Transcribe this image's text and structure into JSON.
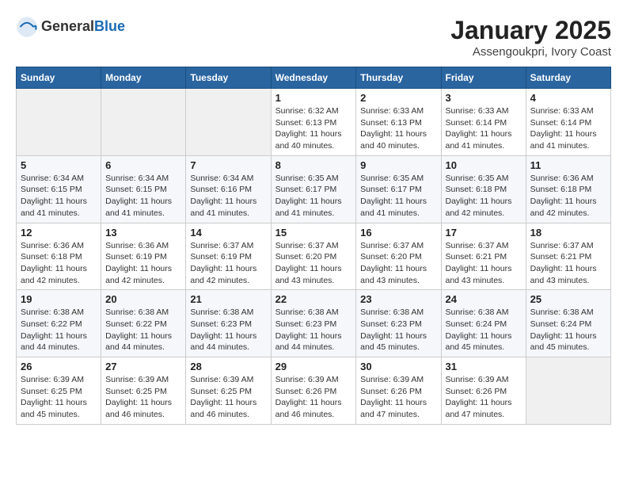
{
  "header": {
    "logo_general": "General",
    "logo_blue": "Blue",
    "title": "January 2025",
    "subtitle": "Assengoukpri, Ivory Coast"
  },
  "weekdays": [
    "Sunday",
    "Monday",
    "Tuesday",
    "Wednesday",
    "Thursday",
    "Friday",
    "Saturday"
  ],
  "weeks": [
    [
      {
        "day": "",
        "info": ""
      },
      {
        "day": "",
        "info": ""
      },
      {
        "day": "",
        "info": ""
      },
      {
        "day": "1",
        "info": "Sunrise: 6:32 AM\nSunset: 6:13 PM\nDaylight: 11 hours and 40 minutes."
      },
      {
        "day": "2",
        "info": "Sunrise: 6:33 AM\nSunset: 6:13 PM\nDaylight: 11 hours and 40 minutes."
      },
      {
        "day": "3",
        "info": "Sunrise: 6:33 AM\nSunset: 6:14 PM\nDaylight: 11 hours and 41 minutes."
      },
      {
        "day": "4",
        "info": "Sunrise: 6:33 AM\nSunset: 6:14 PM\nDaylight: 11 hours and 41 minutes."
      }
    ],
    [
      {
        "day": "5",
        "info": "Sunrise: 6:34 AM\nSunset: 6:15 PM\nDaylight: 11 hours and 41 minutes."
      },
      {
        "day": "6",
        "info": "Sunrise: 6:34 AM\nSunset: 6:15 PM\nDaylight: 11 hours and 41 minutes."
      },
      {
        "day": "7",
        "info": "Sunrise: 6:34 AM\nSunset: 6:16 PM\nDaylight: 11 hours and 41 minutes."
      },
      {
        "day": "8",
        "info": "Sunrise: 6:35 AM\nSunset: 6:17 PM\nDaylight: 11 hours and 41 minutes."
      },
      {
        "day": "9",
        "info": "Sunrise: 6:35 AM\nSunset: 6:17 PM\nDaylight: 11 hours and 41 minutes."
      },
      {
        "day": "10",
        "info": "Sunrise: 6:35 AM\nSunset: 6:18 PM\nDaylight: 11 hours and 42 minutes."
      },
      {
        "day": "11",
        "info": "Sunrise: 6:36 AM\nSunset: 6:18 PM\nDaylight: 11 hours and 42 minutes."
      }
    ],
    [
      {
        "day": "12",
        "info": "Sunrise: 6:36 AM\nSunset: 6:18 PM\nDaylight: 11 hours and 42 minutes."
      },
      {
        "day": "13",
        "info": "Sunrise: 6:36 AM\nSunset: 6:19 PM\nDaylight: 11 hours and 42 minutes."
      },
      {
        "day": "14",
        "info": "Sunrise: 6:37 AM\nSunset: 6:19 PM\nDaylight: 11 hours and 42 minutes."
      },
      {
        "day": "15",
        "info": "Sunrise: 6:37 AM\nSunset: 6:20 PM\nDaylight: 11 hours and 43 minutes."
      },
      {
        "day": "16",
        "info": "Sunrise: 6:37 AM\nSunset: 6:20 PM\nDaylight: 11 hours and 43 minutes."
      },
      {
        "day": "17",
        "info": "Sunrise: 6:37 AM\nSunset: 6:21 PM\nDaylight: 11 hours and 43 minutes."
      },
      {
        "day": "18",
        "info": "Sunrise: 6:37 AM\nSunset: 6:21 PM\nDaylight: 11 hours and 43 minutes."
      }
    ],
    [
      {
        "day": "19",
        "info": "Sunrise: 6:38 AM\nSunset: 6:22 PM\nDaylight: 11 hours and 44 minutes."
      },
      {
        "day": "20",
        "info": "Sunrise: 6:38 AM\nSunset: 6:22 PM\nDaylight: 11 hours and 44 minutes."
      },
      {
        "day": "21",
        "info": "Sunrise: 6:38 AM\nSunset: 6:23 PM\nDaylight: 11 hours and 44 minutes."
      },
      {
        "day": "22",
        "info": "Sunrise: 6:38 AM\nSunset: 6:23 PM\nDaylight: 11 hours and 44 minutes."
      },
      {
        "day": "23",
        "info": "Sunrise: 6:38 AM\nSunset: 6:23 PM\nDaylight: 11 hours and 45 minutes."
      },
      {
        "day": "24",
        "info": "Sunrise: 6:38 AM\nSunset: 6:24 PM\nDaylight: 11 hours and 45 minutes."
      },
      {
        "day": "25",
        "info": "Sunrise: 6:38 AM\nSunset: 6:24 PM\nDaylight: 11 hours and 45 minutes."
      }
    ],
    [
      {
        "day": "26",
        "info": "Sunrise: 6:39 AM\nSunset: 6:25 PM\nDaylight: 11 hours and 45 minutes."
      },
      {
        "day": "27",
        "info": "Sunrise: 6:39 AM\nSunset: 6:25 PM\nDaylight: 11 hours and 46 minutes."
      },
      {
        "day": "28",
        "info": "Sunrise: 6:39 AM\nSunset: 6:25 PM\nDaylight: 11 hours and 46 minutes."
      },
      {
        "day": "29",
        "info": "Sunrise: 6:39 AM\nSunset: 6:26 PM\nDaylight: 11 hours and 46 minutes."
      },
      {
        "day": "30",
        "info": "Sunrise: 6:39 AM\nSunset: 6:26 PM\nDaylight: 11 hours and 47 minutes."
      },
      {
        "day": "31",
        "info": "Sunrise: 6:39 AM\nSunset: 6:26 PM\nDaylight: 11 hours and 47 minutes."
      },
      {
        "day": "",
        "info": ""
      }
    ]
  ]
}
